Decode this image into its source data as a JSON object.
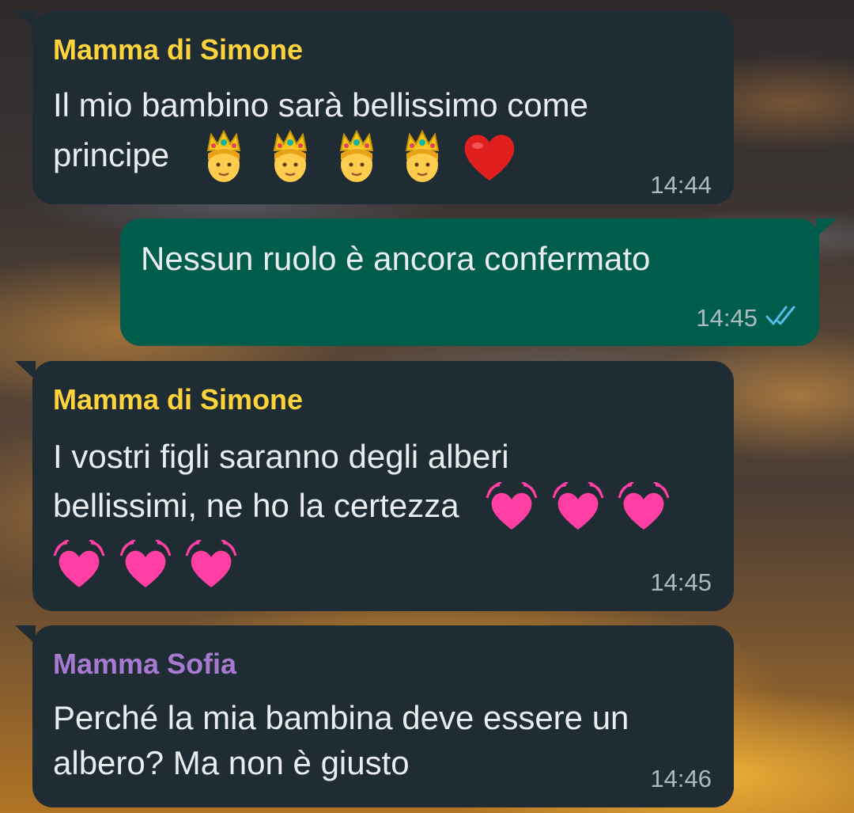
{
  "chat": {
    "messages": [
      {
        "direction": "incoming",
        "sender": "Mamma di Simone",
        "sender_color": "#ffd43b",
        "line1": "Il mio bambino sarà bellissimo come",
        "line2": "principe",
        "emojis": [
          "prince-emoji",
          "prince-emoji",
          "prince-emoji",
          "prince-emoji",
          "red-heart-emoji"
        ],
        "time": "14:44"
      },
      {
        "direction": "outgoing",
        "line1": "Nessun ruolo è ancora confermato",
        "time": "14:45",
        "status": "read-double-check",
        "status_color": "#53bdeb"
      },
      {
        "direction": "incoming",
        "sender": "Mamma di Simone",
        "sender_color": "#ffd43b",
        "line1": "I vostri figli saranno degli alberi",
        "line2": "bellissimi, ne ho la certezza",
        "emojis": [
          "beating-heart-emoji",
          "beating-heart-emoji",
          "beating-heart-emoji",
          "beating-heart-emoji",
          "beating-heart-emoji",
          "beating-heart-emoji"
        ],
        "time": "14:45"
      },
      {
        "direction": "incoming",
        "sender": "Mamma Sofia",
        "sender_color": "#a57ad0",
        "line1": "Perché la mia bambina deve essere un",
        "line2": "albero? Ma non è giusto",
        "time": "14:46"
      }
    ]
  },
  "colors": {
    "incoming_bubble": "#202c33",
    "outgoing_bubble": "#005c4b",
    "text": "#e9edef",
    "meta": "#aebac1"
  }
}
